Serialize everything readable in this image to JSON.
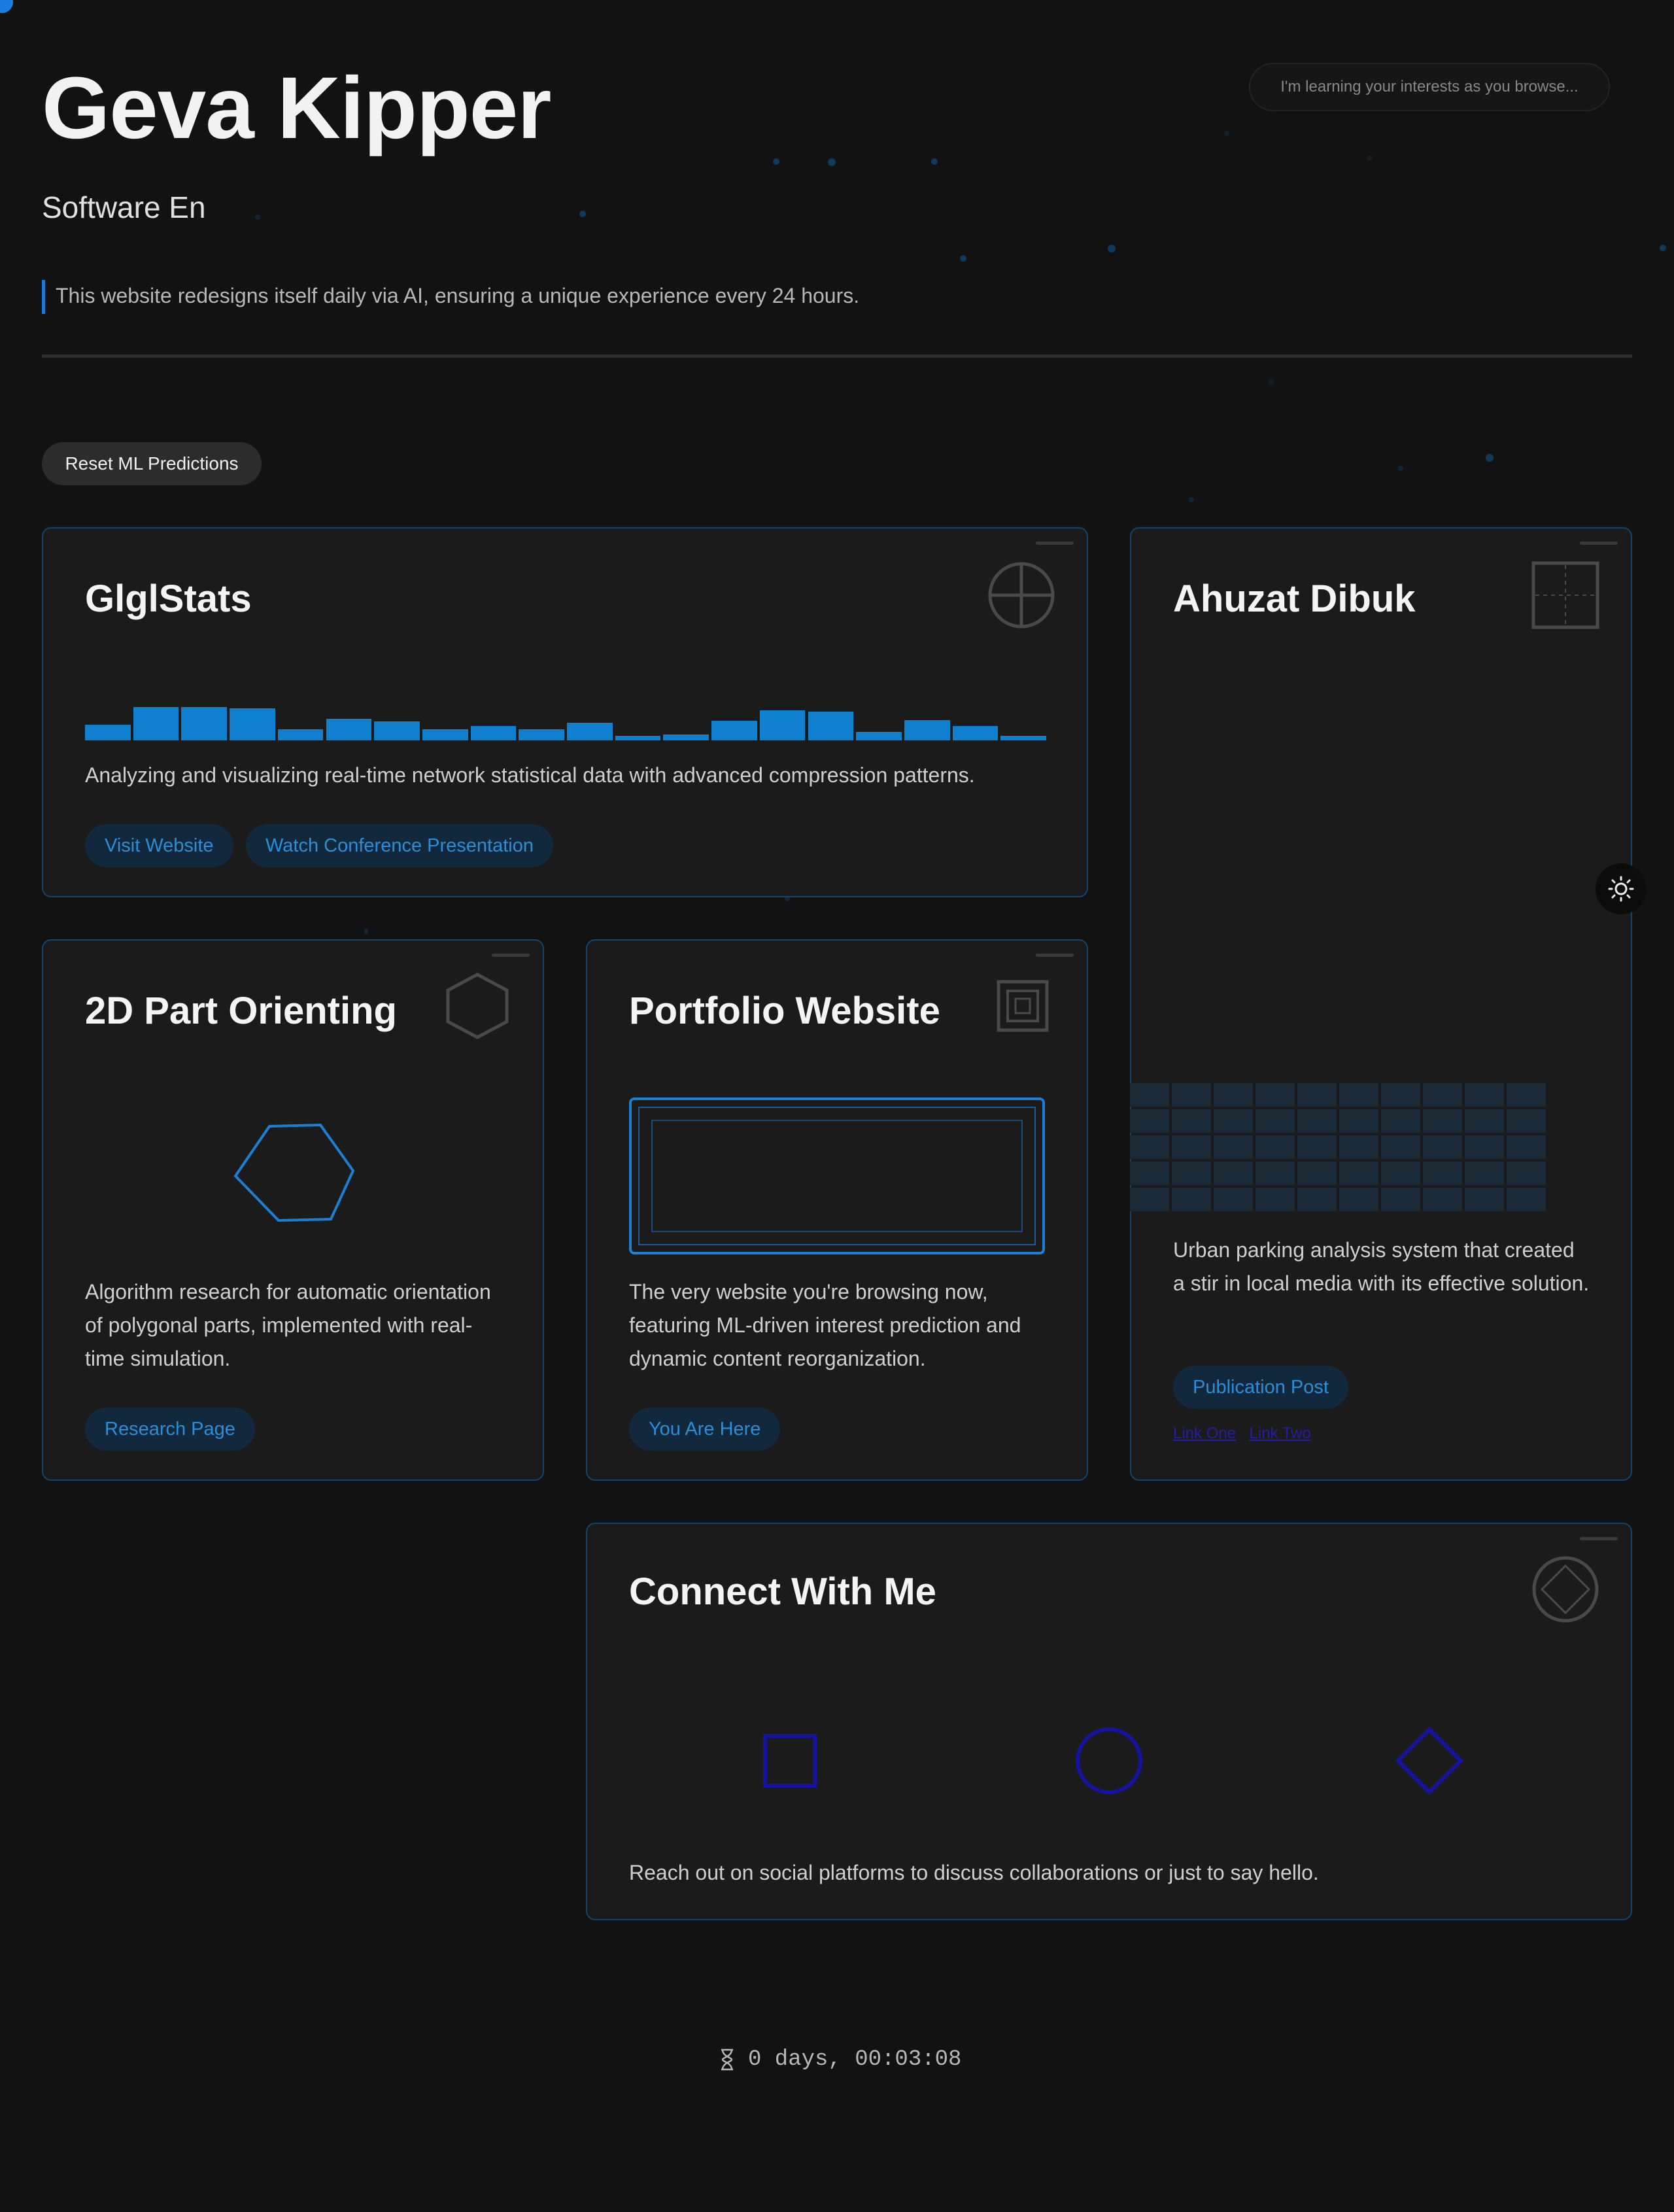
{
  "header": {
    "name": "Geva Kipper",
    "role": "Software En",
    "tagline": "This website redesigns itself daily via AI, ensuring a unique experience every 24 hours."
  },
  "learning_notice": "I'm learning your interests as you browse...",
  "reset_button": "Reset ML Predictions",
  "colors": {
    "background": "#121212",
    "card": "#1b1b1c",
    "card_border": "#12446e",
    "accent": "#1a7ad1",
    "chip_bg": "#12283c",
    "chip_text": "#2a8fd8",
    "connect_icon": "#1414a0"
  },
  "cards": {
    "glglstats": {
      "title": "GlglStats",
      "icon": "crosshair-circle-icon",
      "bars": [
        0.37,
        0.8,
        0.8,
        0.77,
        0.27,
        0.51,
        0.46,
        0.27,
        0.34,
        0.26,
        0.42,
        0.11,
        0.14,
        0.47,
        0.72,
        0.68,
        0.2,
        0.49,
        0.34,
        0.11
      ],
      "description": "Analyzing and visualizing real-time network statistical data with advanced compression patterns.",
      "links": [
        "Visit Website",
        "Watch Conference Presentation"
      ]
    },
    "ahuzat": {
      "title": "Ahuzat Dibuk",
      "icon": "dashed-grid-square-icon",
      "description": "Urban parking analysis system that created a stir in local media with its effective solution.",
      "links": [
        "Publication Post"
      ],
      "small_links": [
        "Link One",
        "Link Two"
      ]
    },
    "part_orienting": {
      "title": "2D Part Orienting",
      "icon": "hexagon-icon",
      "description": "Algorithm research for automatic orientation of polygonal parts, implemented with real-time simulation.",
      "links": [
        "Research Page"
      ]
    },
    "portfolio": {
      "title": "Portfolio Website",
      "icon": "nested-squares-icon",
      "description": "The very website you're browsing now, featuring ML-driven interest prediction and dynamic content reorganization.",
      "links": [
        "You Are Here"
      ]
    },
    "connect": {
      "title": "Connect With Me",
      "icon": "diamond-circle-icon",
      "social_icons": [
        "square-icon",
        "circle-icon",
        "diamond-icon"
      ],
      "description": "Reach out on social platforms to discuss collaborations or just to say hello."
    }
  },
  "timer": "0 days, 00:03:08"
}
